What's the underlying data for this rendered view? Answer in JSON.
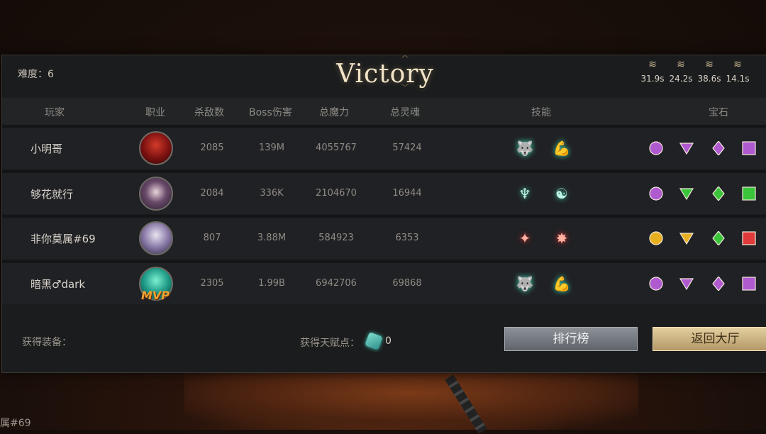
{
  "header": {
    "difficulty": "难度：6",
    "title": "Victory",
    "wave_times": [
      "31.9s",
      "24.2s",
      "38.6s",
      "14.1s"
    ]
  },
  "columns": [
    "玩家",
    "职业",
    "杀敌数",
    "Boss伤害",
    "总魔力",
    "总灵魂",
    "技能",
    "宝石"
  ],
  "players": [
    {
      "name": "小明哥",
      "kills": "2085",
      "boss_damage": "139M",
      "total_mana": "4055767",
      "total_soul": "57424",
      "class_icon": "demon-avatar",
      "mvp": false,
      "skills": [
        {
          "icon": "wolf-icon",
          "color": "teal"
        },
        {
          "icon": "arm-icon",
          "color": "teal"
        }
      ],
      "gems": [
        {
          "shape": "circle",
          "color": "#b05ad0"
        },
        {
          "shape": "triangle",
          "color": "#b05ad0"
        },
        {
          "shape": "diamond",
          "color": "#b05ad0"
        },
        {
          "shape": "square",
          "color": "#b05ad0"
        }
      ]
    },
    {
      "name": "够花就行",
      "kills": "2084",
      "boss_damage": "336K",
      "total_mana": "2104670",
      "total_soul": "16944",
      "class_icon": "priestess-avatar",
      "mvp": false,
      "skills": [
        {
          "icon": "tree-icon",
          "color": "teal"
        },
        {
          "icon": "head-icon",
          "color": "teal"
        }
      ],
      "gems": [
        {
          "shape": "circle",
          "color": "#b05ad0"
        },
        {
          "shape": "triangle",
          "color": "#3ac43a"
        },
        {
          "shape": "diamond",
          "color": "#3ac43a"
        },
        {
          "shape": "square",
          "color": "#3ac43a"
        }
      ]
    },
    {
      "name": "非你莫属#69",
      "kills": "807",
      "boss_damage": "3.88M",
      "total_mana": "584923",
      "total_soul": "6353",
      "class_icon": "elf-avatar",
      "mvp": false,
      "skills": [
        {
          "icon": "claw-icon",
          "color": "red"
        },
        {
          "icon": "burst-icon",
          "color": "red"
        }
      ],
      "gems": [
        {
          "shape": "circle",
          "color": "#e8b020"
        },
        {
          "shape": "triangle",
          "color": "#e8b020"
        },
        {
          "shape": "diamond",
          "color": "#3ac43a"
        },
        {
          "shape": "square",
          "color": "#e03a3a"
        }
      ]
    },
    {
      "name": "暗黑♂dark",
      "kills": "2305",
      "boss_damage": "1.99B",
      "total_mana": "6942706",
      "total_soul": "69868",
      "class_icon": "medusa-avatar",
      "mvp": true,
      "skills": [
        {
          "icon": "wolf-icon",
          "color": "teal"
        },
        {
          "icon": "arm-icon",
          "color": "teal"
        }
      ],
      "gems": [
        {
          "shape": "circle",
          "color": "#b05ad0"
        },
        {
          "shape": "triangle",
          "color": "#b05ad0"
        },
        {
          "shape": "diamond",
          "color": "#b05ad0"
        },
        {
          "shape": "square",
          "color": "#b05ad0"
        }
      ]
    }
  ],
  "mvp_label": "MVP",
  "footer": {
    "equipment_label": "获得装备：",
    "talent_label": "获得天赋点：",
    "talent_points": "0",
    "rank_button": "排行榜",
    "lobby_button": "返回大厅"
  },
  "background": {
    "corner_name": "属#69"
  }
}
